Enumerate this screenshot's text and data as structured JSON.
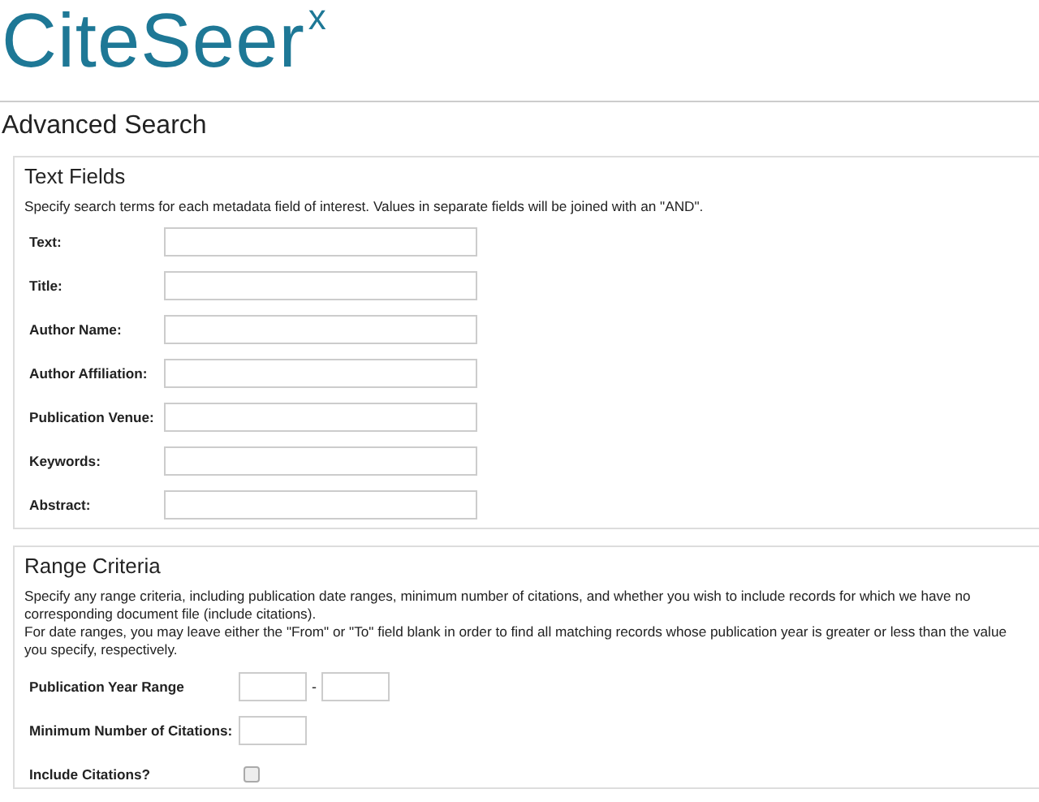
{
  "logo": {
    "name": "CiteSeer",
    "superscript": "x"
  },
  "heading": "Advanced Search",
  "text_fields": {
    "title": "Text Fields",
    "description": "Specify search terms for each metadata field of interest. Values in separate fields will be joined with an \"AND\".",
    "fields": [
      {
        "label": "Text:"
      },
      {
        "label": "Title:"
      },
      {
        "label": "Author Name:"
      },
      {
        "label": "Author Affiliation:"
      },
      {
        "label": "Publication Venue:"
      },
      {
        "label": "Keywords:"
      },
      {
        "label": "Abstract:"
      }
    ]
  },
  "range_criteria": {
    "title": "Range Criteria",
    "description": [
      "Specify any range criteria, including publication date ranges, minimum number of citations, and whether you wish to include records for which we have no corresponding document file (include citations).",
      "For date ranges, you may leave either the \"From\" or \"To\" field blank in order to find all matching records whose publication year is greater or less than the value you specify, respectively."
    ],
    "fields": [
      {
        "kind": "range",
        "label": "Publication Year Range",
        "separator": "-"
      },
      {
        "kind": "number",
        "label": "Minimum Number of Citations:"
      },
      {
        "kind": "checkbox",
        "label": "Include Citations?",
        "checked": false
      }
    ]
  }
}
